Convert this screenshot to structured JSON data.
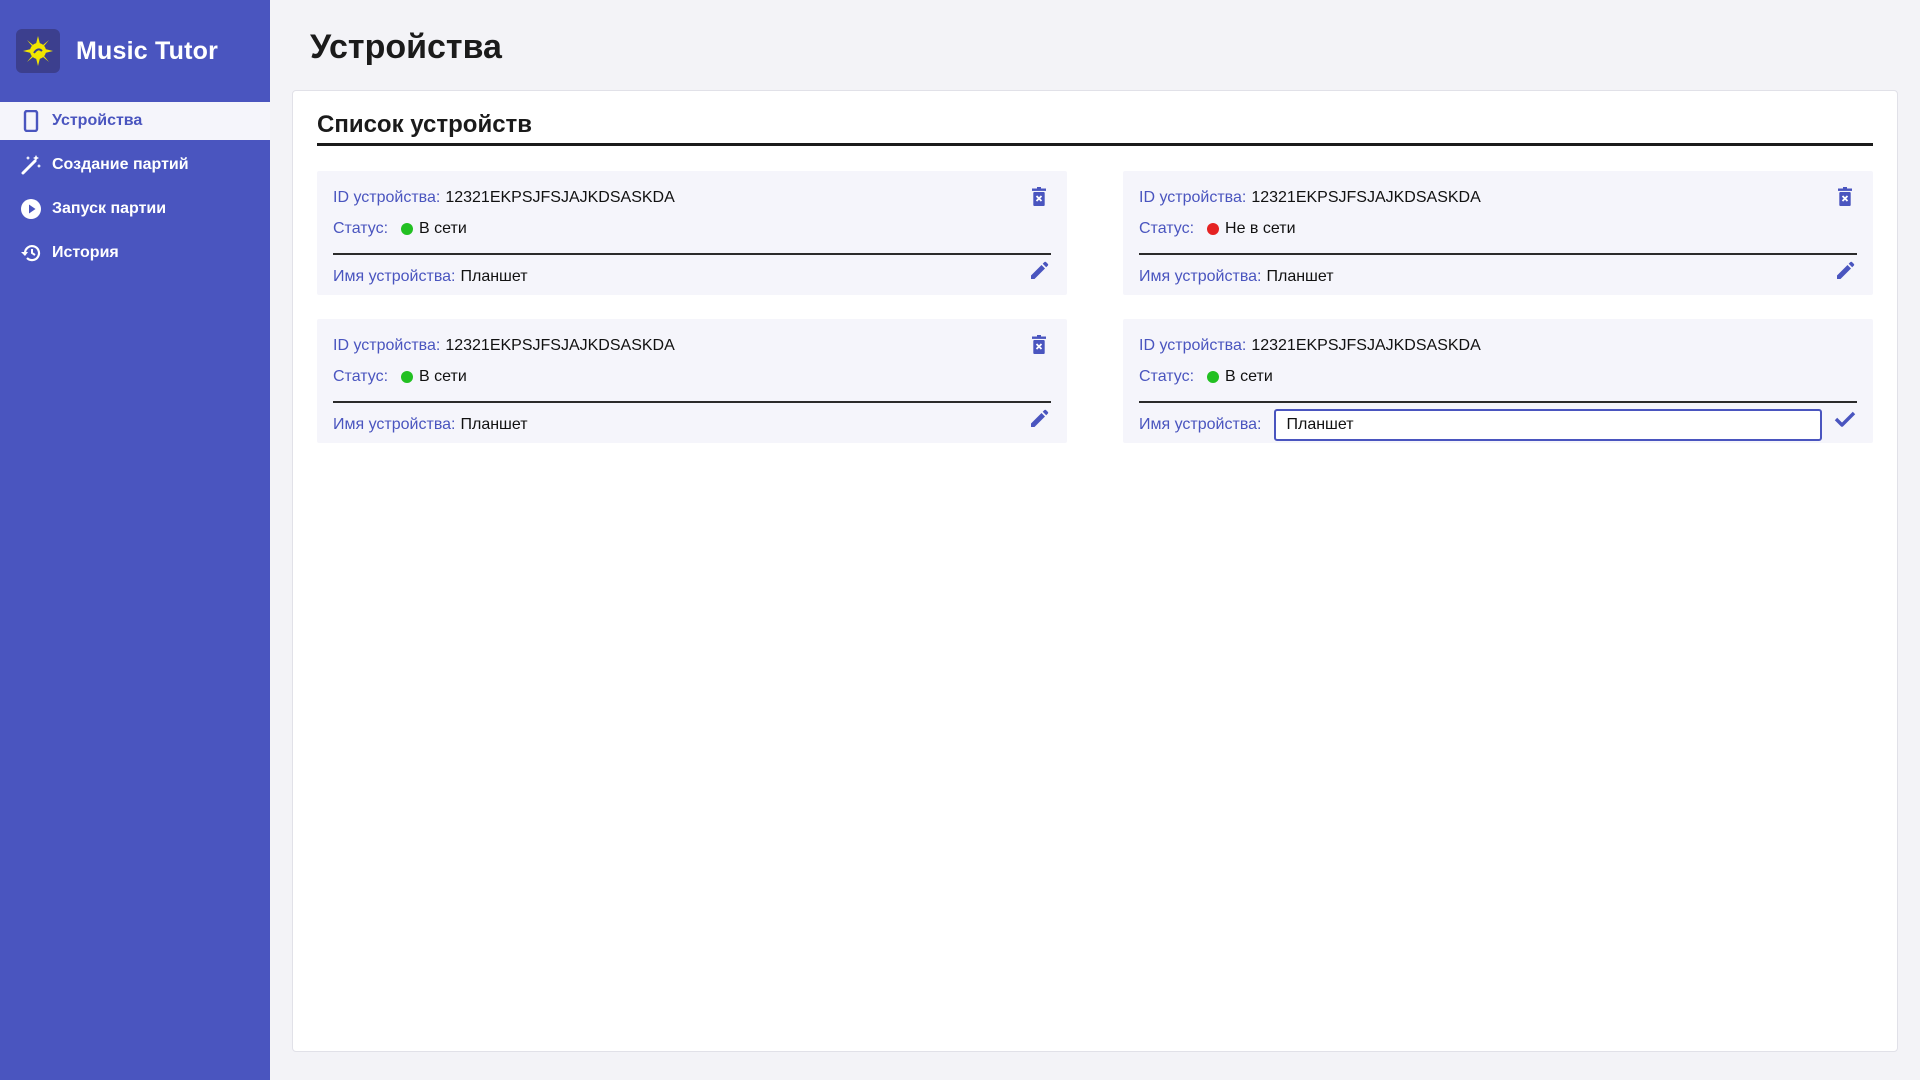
{
  "app": {
    "title": "Music Tutor"
  },
  "sidebar": {
    "items": [
      {
        "label": "Устройства",
        "icon": "tablet-icon",
        "active": true
      },
      {
        "label": "Создание партий",
        "icon": "magic-wand-icon",
        "active": false
      },
      {
        "label": "Запуск партии",
        "icon": "play-circle-icon",
        "active": false
      },
      {
        "label": "История",
        "icon": "history-icon",
        "active": false
      }
    ]
  },
  "page": {
    "title": "Устройства"
  },
  "panel": {
    "title": "Список устройств"
  },
  "labels": {
    "device_id": "ID устройства:",
    "status": "Статус:",
    "device_name": "Имя устройства:"
  },
  "devices": [
    {
      "id": "12321EKPSJFSJAJKDSASKDA",
      "status": "В сети",
      "status_color": "#22c022",
      "name": "Планшет",
      "editing": false
    },
    {
      "id": "12321EKPSJFSJAJKDSASKDA",
      "status": "Не в сети",
      "status_color": "#e52222",
      "name": "Планшет",
      "editing": false
    },
    {
      "id": "12321EKPSJFSJAJKDSASKDA",
      "status": "В сети",
      "status_color": "#22c022",
      "name": "Планшет",
      "editing": false
    },
    {
      "id": "12321EKPSJFSJAJKDSASKDA",
      "status": "В сети",
      "status_color": "#22c022",
      "name": "Планшет",
      "editing": true
    }
  ],
  "colors": {
    "accent": "#4a55bf",
    "online": "#22c022",
    "offline": "#e52222"
  }
}
